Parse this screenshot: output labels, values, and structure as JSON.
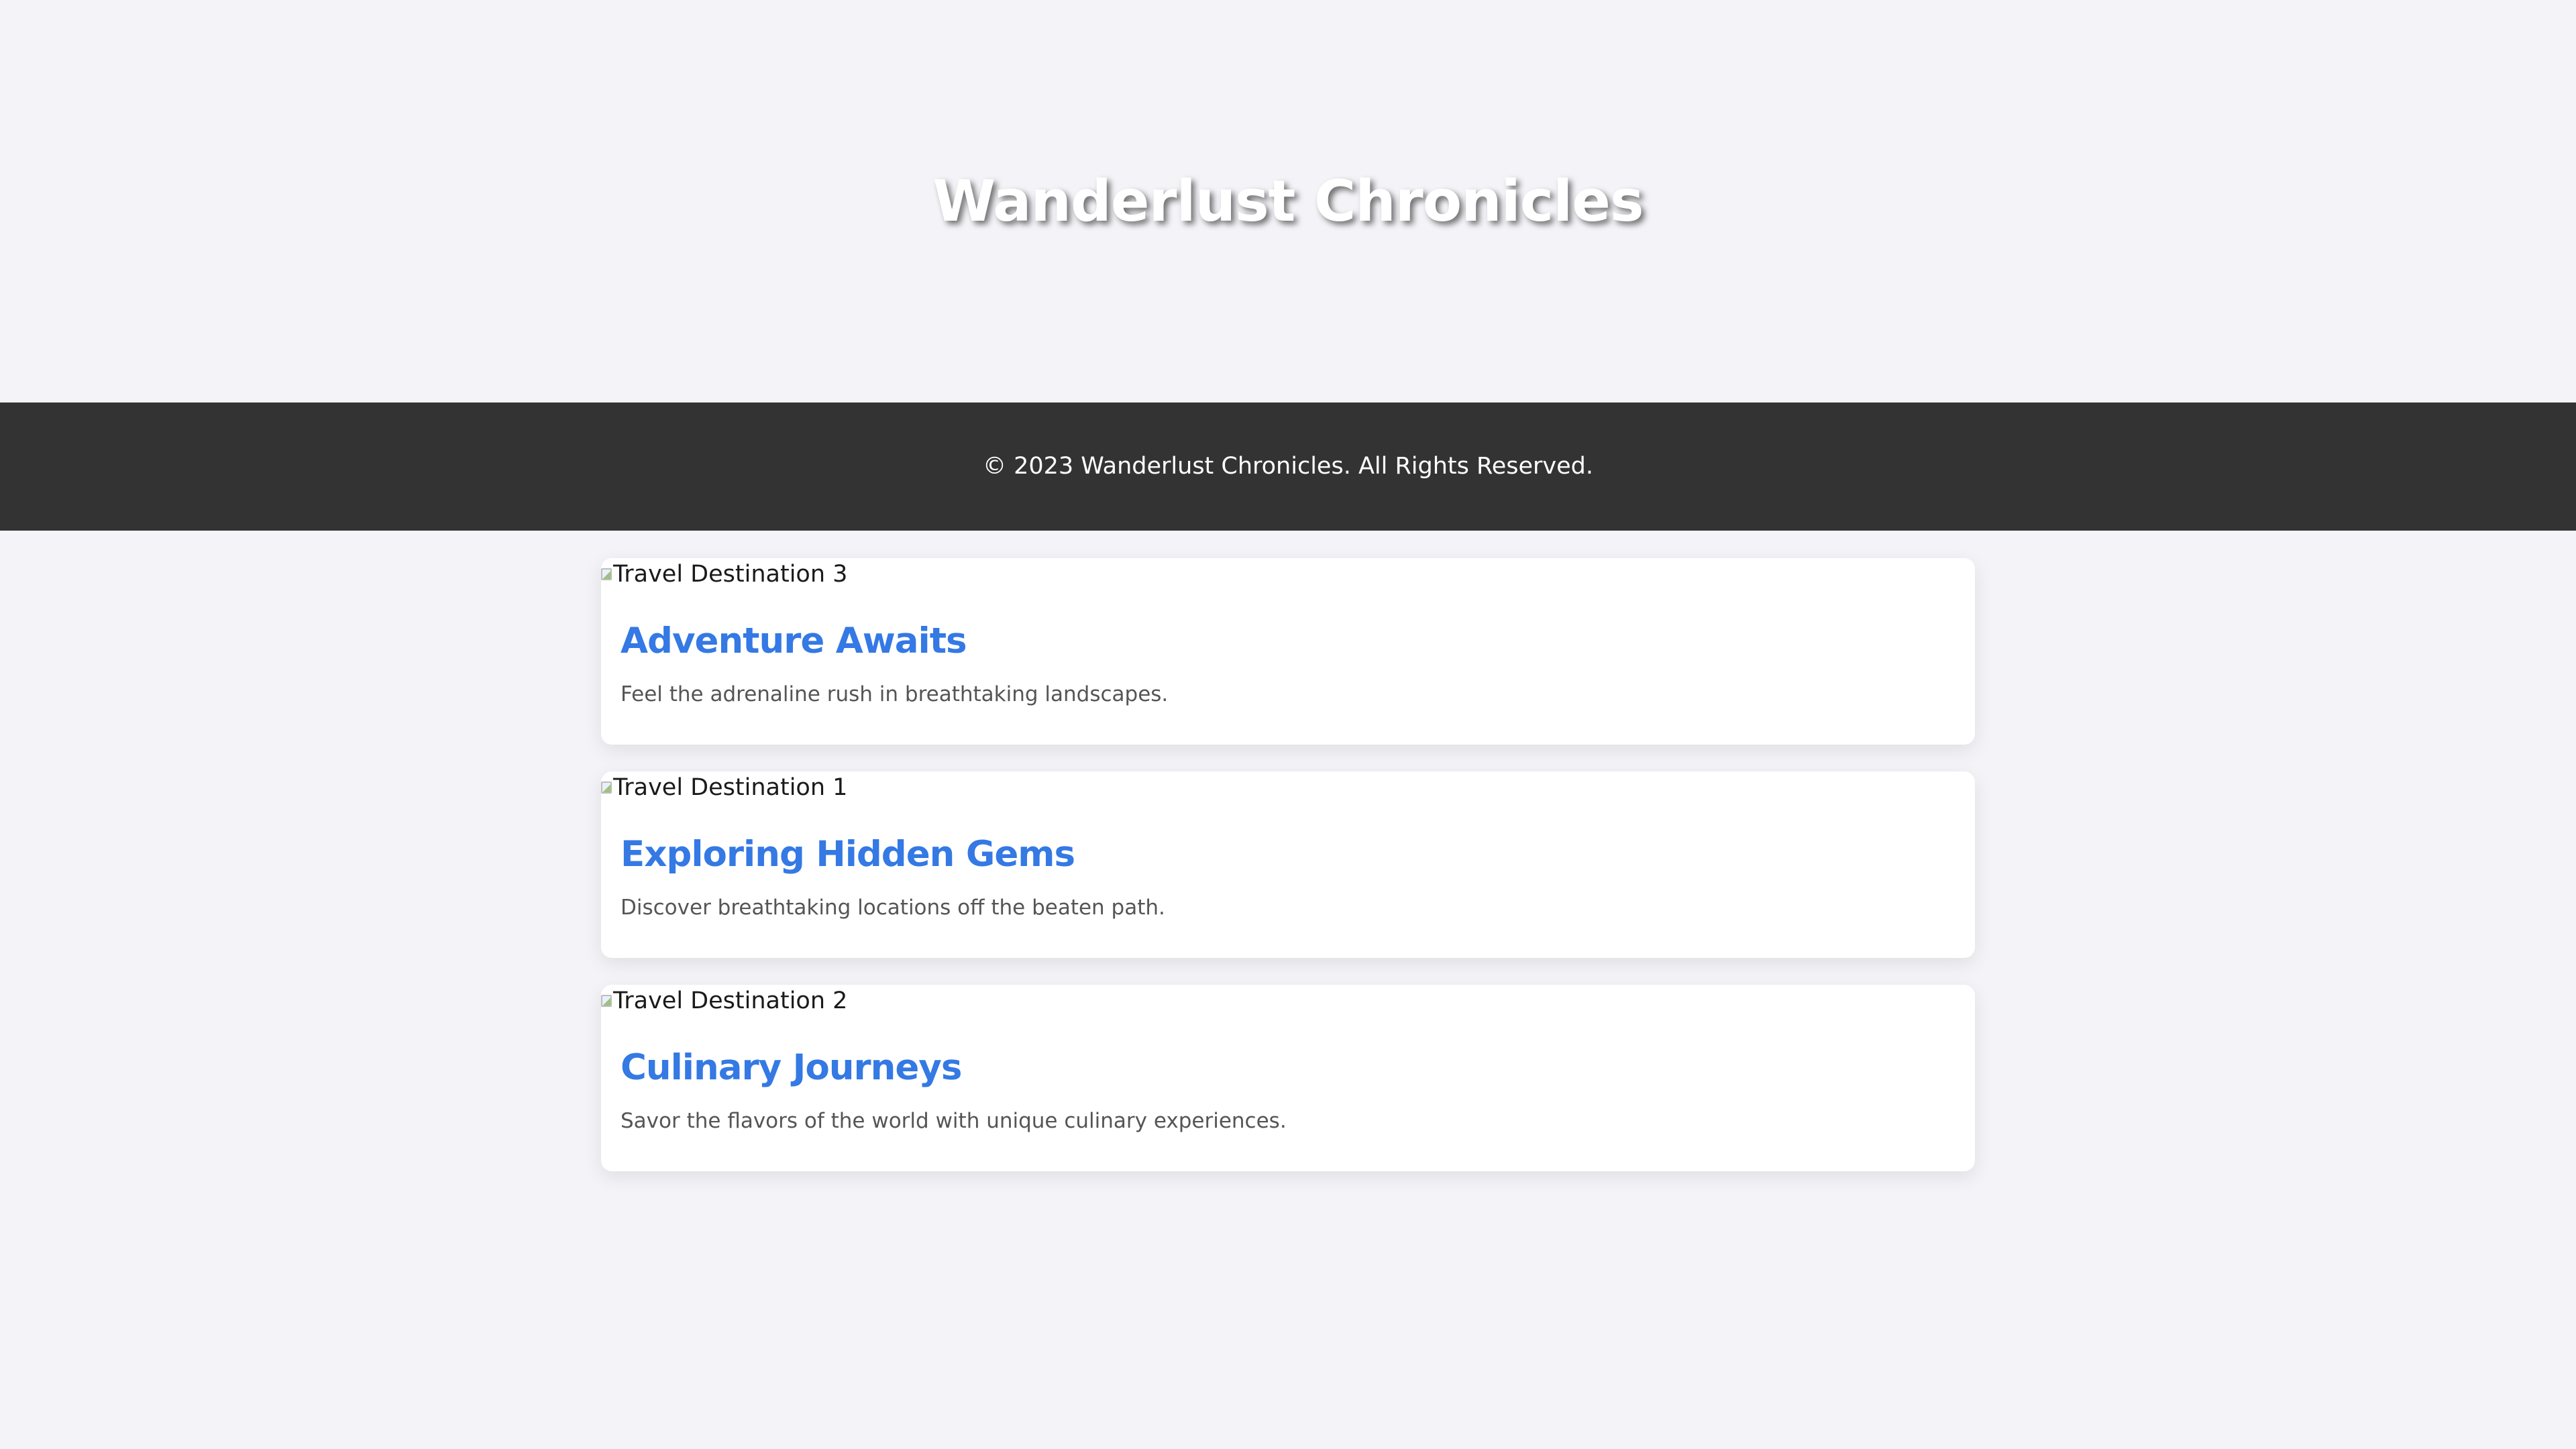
{
  "header": {
    "title": "Wanderlust Chronicles"
  },
  "footer": {
    "copyright": "© 2023 Wanderlust Chronicles. All Rights Reserved."
  },
  "cards": [
    {
      "image_alt": "Travel Destination 3",
      "title": "Adventure Awaits",
      "description": "Feel the adrenaline rush in breathtaking landscapes."
    },
    {
      "image_alt": "Travel Destination 1",
      "title": "Exploring Hidden Gems",
      "description": "Discover breathtaking locations off the beaten path."
    },
    {
      "image_alt": "Travel Destination 2",
      "title": "Culinary Journeys",
      "description": "Savor the flavors of the world with unique culinary experiences."
    }
  ],
  "colors": {
    "background": "#f4f4f8",
    "footer_background": "#333333",
    "card_title": "#3479e4",
    "card_description": "#555555"
  },
  "icons": {
    "card_image": "broken-image-icon"
  }
}
